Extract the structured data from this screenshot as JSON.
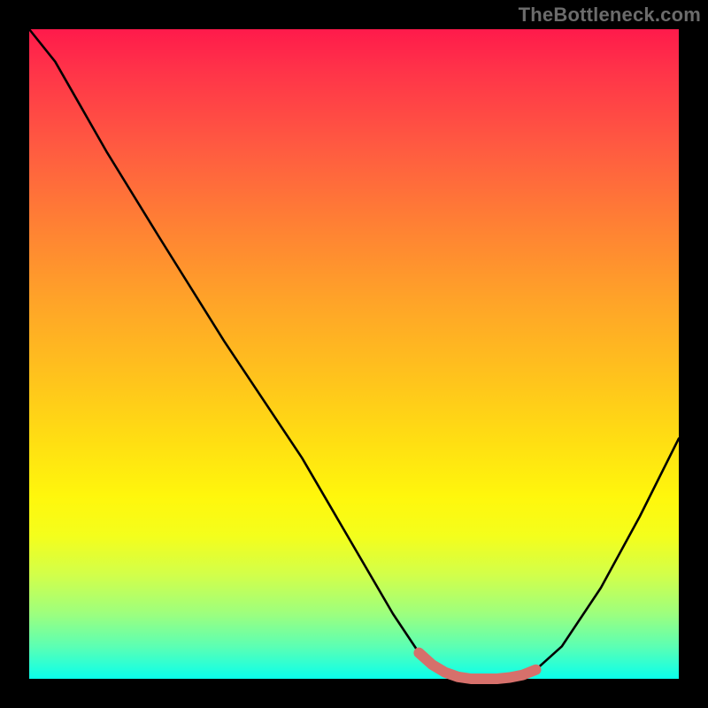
{
  "watermark": "TheBottleneck.com",
  "chart_data": {
    "type": "line",
    "title": "",
    "xlabel": "",
    "ylabel": "",
    "xlim": [
      0,
      1
    ],
    "ylim": [
      0,
      1
    ],
    "main_curve": {
      "name": "bottleneck-curve",
      "color": "#000000",
      "x": [
        0.0,
        0.04,
        0.08,
        0.12,
        0.2,
        0.3,
        0.42,
        0.56,
        0.6,
        0.62,
        0.64,
        0.66,
        0.68,
        0.7,
        0.72,
        0.74,
        0.76,
        0.78,
        0.82,
        0.88,
        0.94,
        1.0
      ],
      "y": [
        1.0,
        0.95,
        0.88,
        0.81,
        0.68,
        0.52,
        0.34,
        0.1,
        0.04,
        0.022,
        0.01,
        0.003,
        0.0,
        0.0,
        0.0,
        0.002,
        0.006,
        0.014,
        0.05,
        0.14,
        0.25,
        0.37
      ]
    },
    "highlight_segment": {
      "name": "optimal-range",
      "color": "#d6706b",
      "x": [
        0.6,
        0.62,
        0.64,
        0.66,
        0.68,
        0.7,
        0.72,
        0.74,
        0.76,
        0.78
      ],
      "y": [
        0.04,
        0.022,
        0.01,
        0.003,
        0.0,
        0.0,
        0.0,
        0.002,
        0.006,
        0.014
      ]
    },
    "gradient_stops": [
      {
        "offset": 0.0,
        "color": "#ff1a4b"
      },
      {
        "offset": 0.06,
        "color": "#ff3249"
      },
      {
        "offset": 0.18,
        "color": "#ff5a41"
      },
      {
        "offset": 0.3,
        "color": "#ff8034"
      },
      {
        "offset": 0.42,
        "color": "#ffa428"
      },
      {
        "offset": 0.54,
        "color": "#ffc41c"
      },
      {
        "offset": 0.64,
        "color": "#ffe012"
      },
      {
        "offset": 0.72,
        "color": "#fff70c"
      },
      {
        "offset": 0.78,
        "color": "#f4fe1c"
      },
      {
        "offset": 0.84,
        "color": "#d2ff4a"
      },
      {
        "offset": 0.9,
        "color": "#9dff7e"
      },
      {
        "offset": 0.95,
        "color": "#5cffb3"
      },
      {
        "offset": 0.98,
        "color": "#2affd6"
      },
      {
        "offset": 1.0,
        "color": "#0affea"
      }
    ]
  }
}
